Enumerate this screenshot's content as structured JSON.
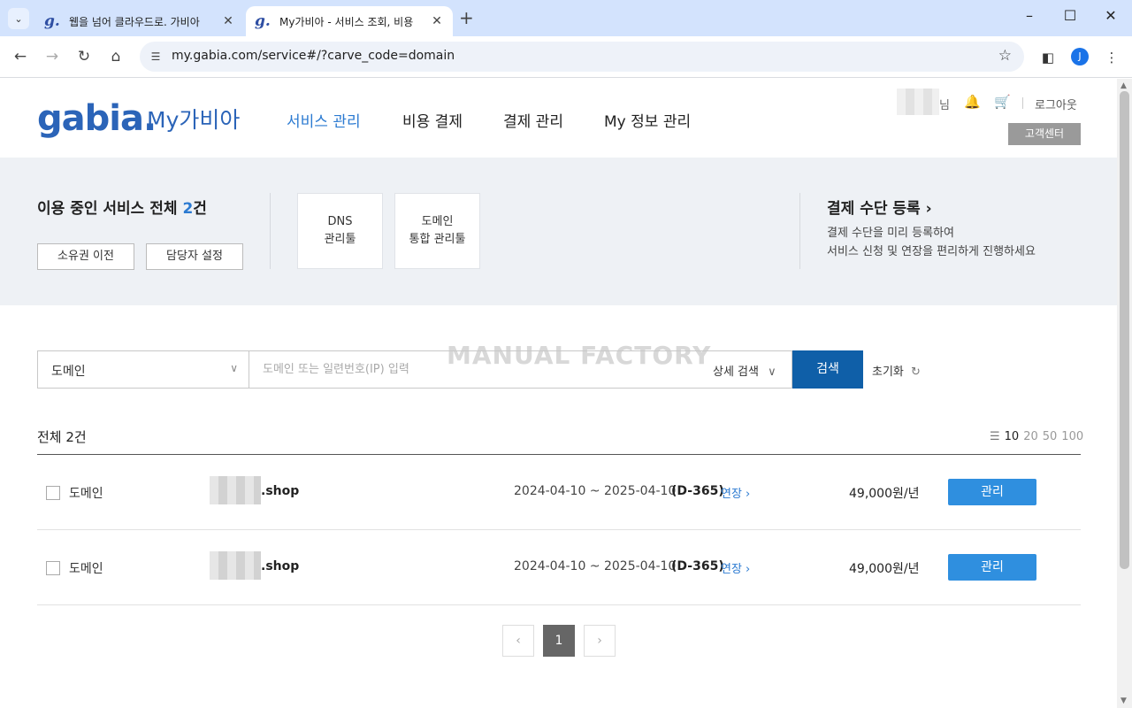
{
  "browser": {
    "tabs": [
      {
        "title": "웹을 넘어 클라우드로. 가비아",
        "favicon": "g."
      },
      {
        "title": "My가비아 - 서비스 조회, 비용",
        "favicon": "g."
      }
    ],
    "url": "my.gabia.com/service#/?carve_code=domain",
    "profile_initial": "J"
  },
  "header": {
    "logo": "gabia.",
    "logo_sub": "My가비아",
    "nav": [
      "서비스 관리",
      "비용 결제",
      "결제 관리",
      "My 정보 관리"
    ],
    "active_nav": "서비스 관리",
    "user_suffix": "님",
    "logout": "로그아웃",
    "customer_center": "고객센터"
  },
  "summary": {
    "title_prefix": "이용 중인 서비스 전체 ",
    "count": "2",
    "title_suffix": "건",
    "buttons": [
      "소유권 이전",
      "담당자 설정"
    ],
    "tools": [
      {
        "line1": "DNS",
        "line2": "관리툴"
      },
      {
        "line1": "도메인",
        "line2": "통합 관리툴"
      }
    ],
    "payment": {
      "title": "결제 수단 등록",
      "desc1": "결제 수단을 미리 등록하여",
      "desc2": "서비스 신청 및 연장을 편리하게 진행하세요"
    }
  },
  "search": {
    "watermark": "MANUAL FACTORY",
    "select_value": "도메인",
    "placeholder": "도메인 또는 일련번호(IP) 입력",
    "advanced": "상세 검색",
    "button": "검색",
    "reset": "초기화"
  },
  "list": {
    "total": "전체 2건",
    "page_sizes": [
      "10",
      "20",
      "50",
      "100"
    ],
    "active_page_size": "10",
    "rows": [
      {
        "type": "도메인",
        "domain_suffix": ".shop",
        "period": "2024-04-10 ~ 2025-04-10",
        "dday": "(D-365)",
        "renew": "연장",
        "price": "49,000원/년",
        "action": "관리"
      },
      {
        "type": "도메인",
        "domain_suffix": ".shop",
        "period": "2024-04-10 ~ 2025-04-10",
        "dday": "(D-365)",
        "renew": "연장",
        "price": "49,000원/년",
        "action": "관리"
      }
    ]
  },
  "pagination": {
    "prev": "‹",
    "current": "1",
    "next": "›"
  },
  "colors": {
    "brand": "#2b64b8",
    "accent": "#2b7ad1",
    "search_button": "#0f5fa8",
    "manage_button": "#2f8fdf"
  }
}
